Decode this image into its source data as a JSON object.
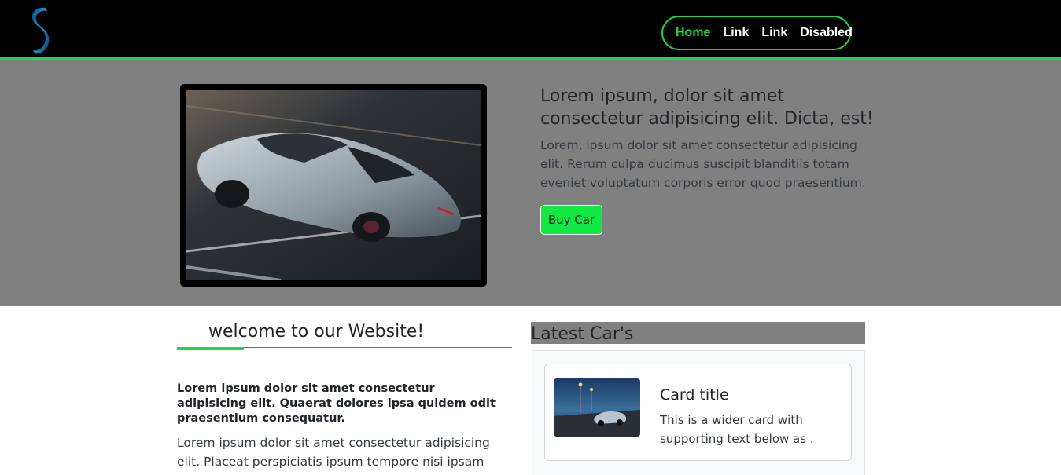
{
  "nav": {
    "links": [
      {
        "label": "Home"
      },
      {
        "label": "Link"
      },
      {
        "label": "Link"
      },
      {
        "label": "Disabled"
      }
    ],
    "accent_color": "#1ed84a"
  },
  "hero": {
    "title": "Lorem ipsum, dolor sit amet consectetur adipisicing elit. Dicta, est!",
    "text": "Lorem, ipsum dolor sit amet consectetur adipisicing elit. Rerum culpa ducimus suscipit blanditiis totam eveniet voluptatum corporis error quod praesentium.",
    "button_label": "Buy Car",
    "button_color": "#12e843"
  },
  "welcome": {
    "title": "welcome to our Website!",
    "lead": "Lorem ipsum dolor sit amet consectetur adipisicing elit. Quaerat dolores ipsa quidem odit praesentium consequatur.",
    "body": "Lorem ipsum dolor sit amet consectetur adipisicing elit. Placeat perspiciatis ipsum tempore nisi ipsam molestiae aut"
  },
  "latest": {
    "title": "Latest Car's",
    "card": {
      "title": "Card title",
      "text": "This is a wider card with supporting text below as ."
    }
  }
}
